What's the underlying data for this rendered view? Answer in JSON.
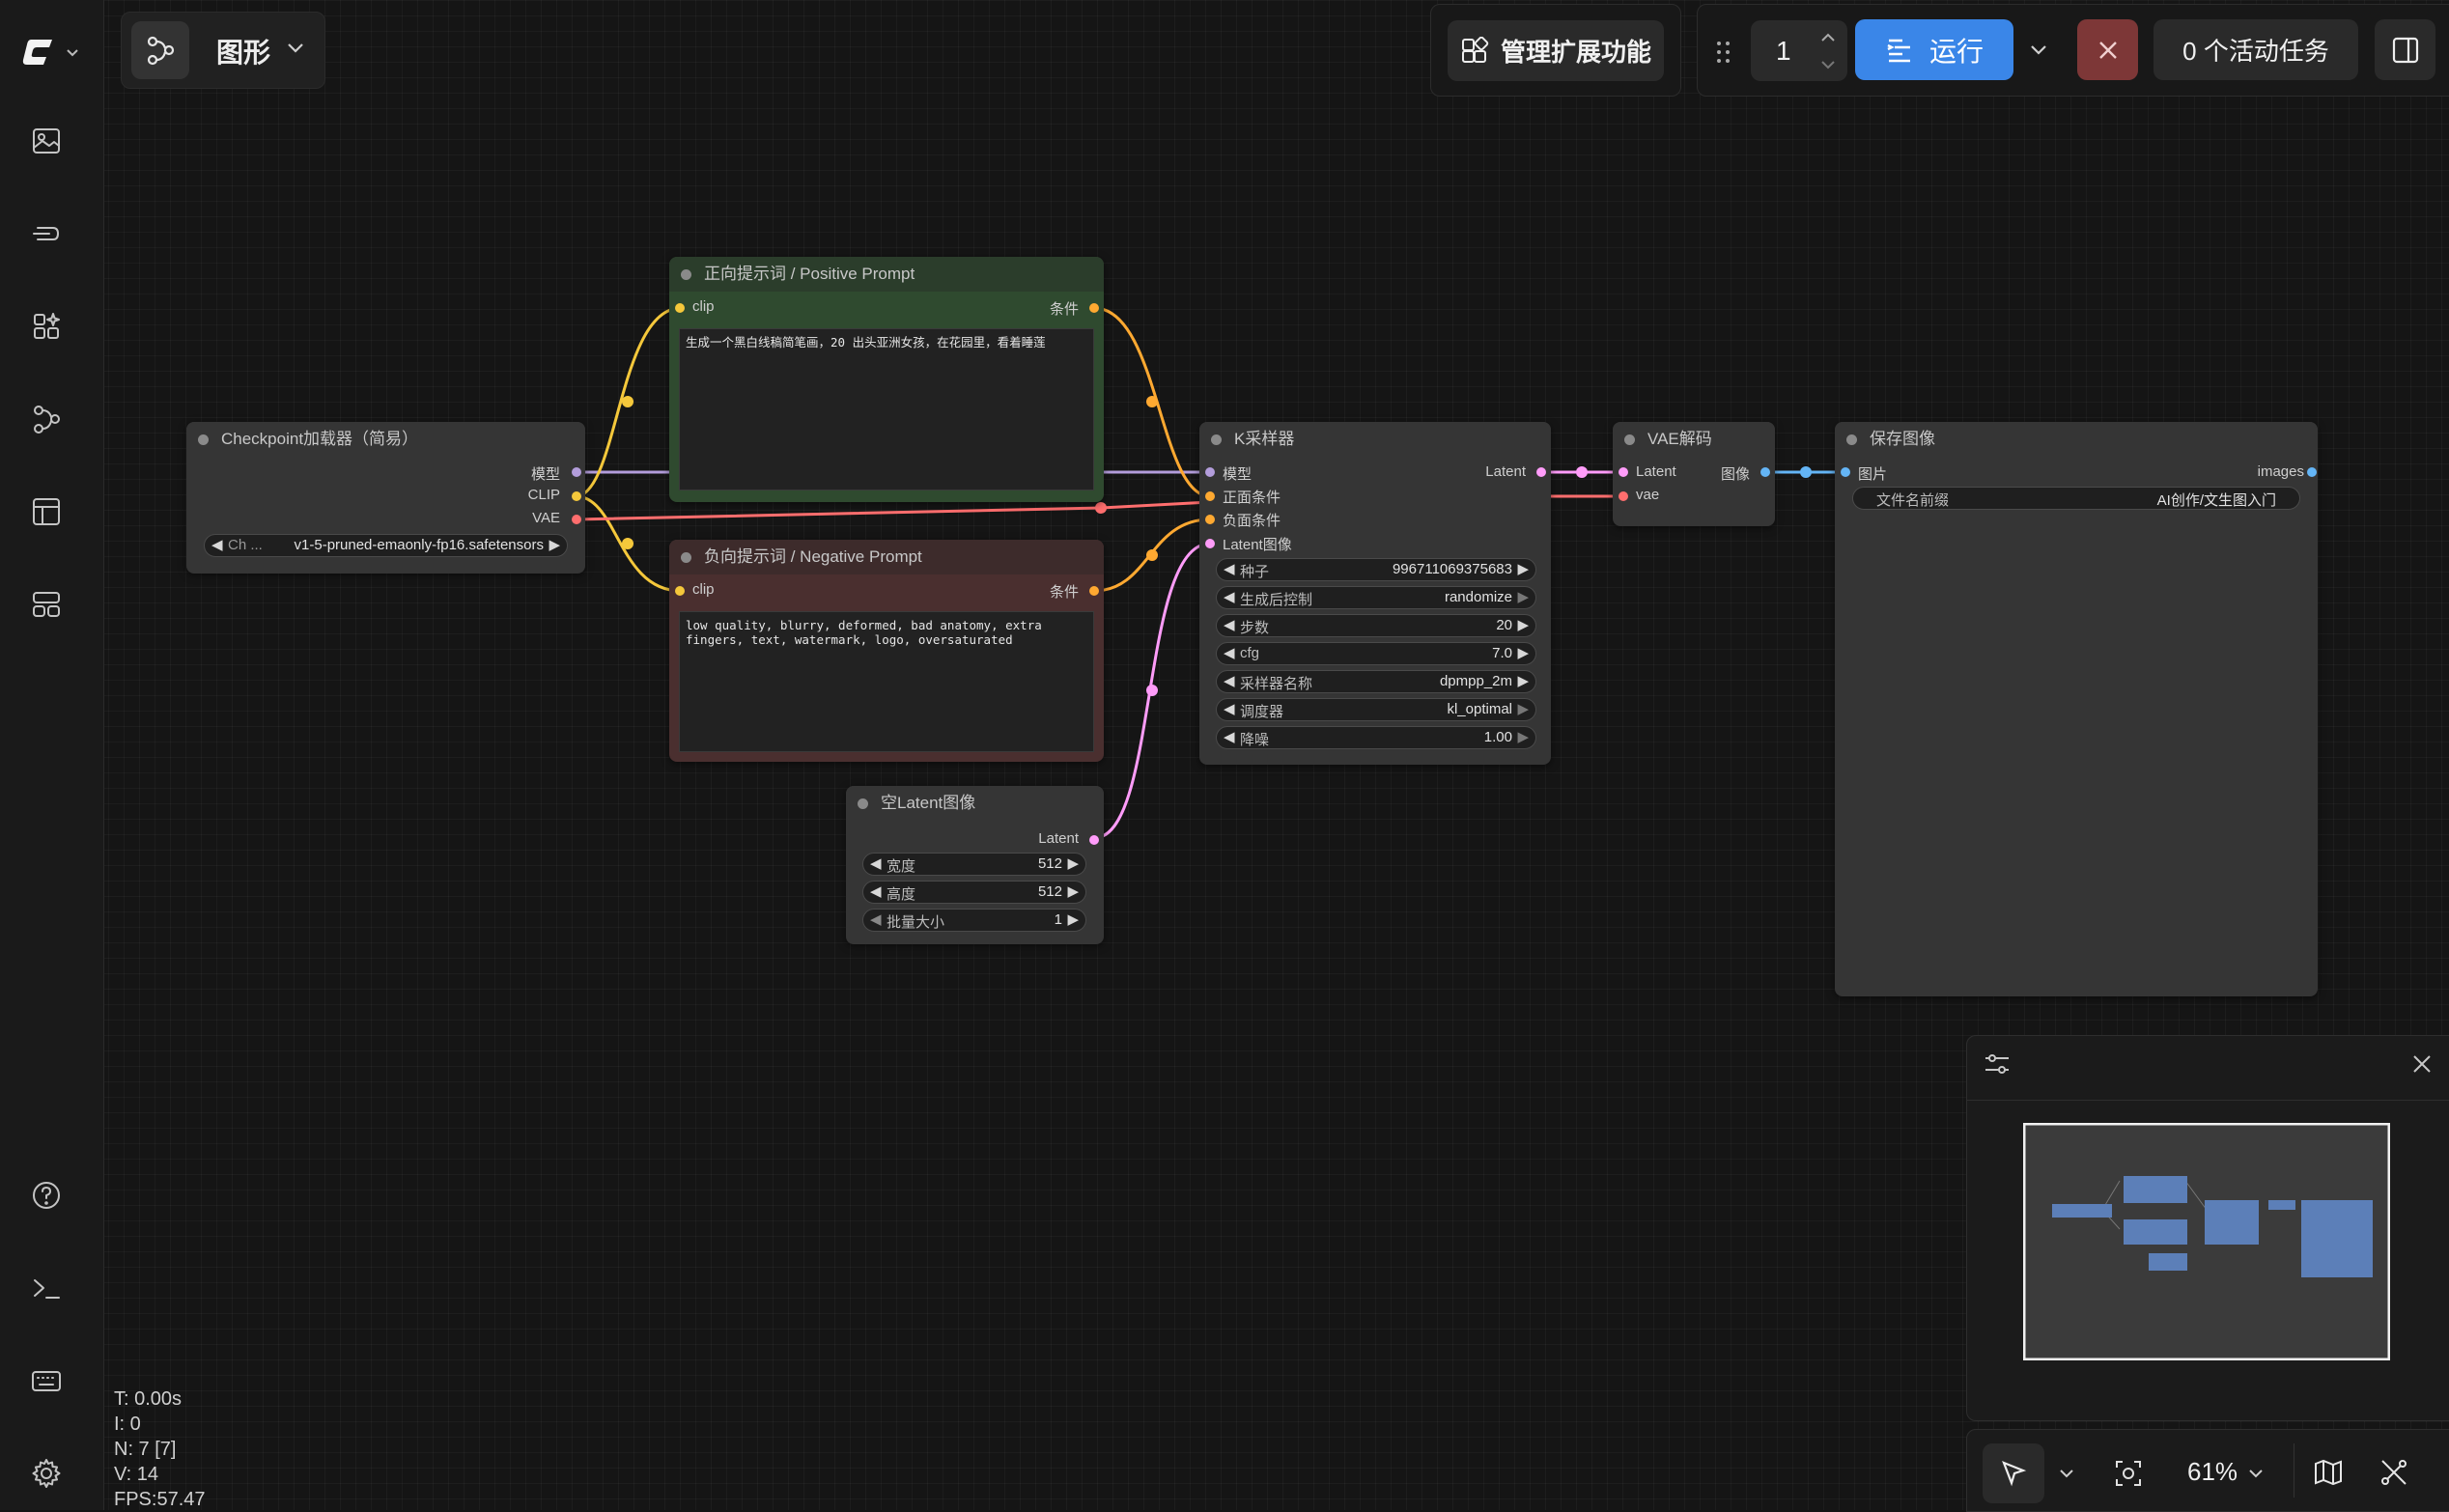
{
  "app": {
    "graph_tab_label": "图形"
  },
  "toolbar": {
    "manage_extensions": "管理扩展功能",
    "queue_count": "1",
    "run_label": "运行",
    "active_tasks": "0 个活动任务"
  },
  "sidebar": {
    "icons": [
      "images-icon",
      "model-library-icon",
      "node-library-icon",
      "workflows-icon",
      "templates-icon",
      "queue-icon"
    ],
    "bottom_icons": [
      "help-icon",
      "terminal-icon",
      "keyboard-icon",
      "settings-icon"
    ]
  },
  "nodes": {
    "checkpoint": {
      "title": "Checkpoint加载器（简易）",
      "outputs": [
        "模型",
        "CLIP",
        "VAE"
      ],
      "widget_label": "Ch ...",
      "widget_value": "v1-5-pruned-emaonly-fp16.safetensors"
    },
    "positive": {
      "title": "正向提示词 / Positive Prompt",
      "input": "clip",
      "output": "条件",
      "text": "生成一个黑白线稿简笔画，20 出头亚洲女孩，在花园里，看着睡莲"
    },
    "negative": {
      "title": "负向提示词 / Negative Prompt",
      "input": "clip",
      "output": "条件",
      "text": "low quality, blurry, deformed, bad anatomy, extra\nfingers, text, watermark, logo, oversaturated"
    },
    "empty_latent": {
      "title": "空Latent图像",
      "output": "Latent",
      "widgets": [
        {
          "label": "宽度",
          "value": "512"
        },
        {
          "label": "高度",
          "value": "512"
        },
        {
          "label": "批量大小",
          "value": "1"
        }
      ]
    },
    "ksampler": {
      "title": "K采样器",
      "inputs": [
        "模型",
        "正面条件",
        "负面条件",
        "Latent图像"
      ],
      "output": "Latent",
      "widgets": [
        {
          "label": "种子",
          "value": "996711069375683"
        },
        {
          "label": "生成后控制",
          "value": "randomize"
        },
        {
          "label": "步数",
          "value": "20"
        },
        {
          "label": "cfg",
          "value": "7.0"
        },
        {
          "label": "采样器名称",
          "value": "dpmpp_2m"
        },
        {
          "label": "调度器",
          "value": "kl_optimal"
        },
        {
          "label": "降噪",
          "value": "1.00"
        }
      ]
    },
    "vae_decode": {
      "title": "VAE解码",
      "inputs": [
        "Latent",
        "vae"
      ],
      "output": "图像"
    },
    "save_image": {
      "title": "保存图像",
      "input": "图片",
      "output": "images",
      "widget_label": "文件名前缀",
      "widget_value": "AI创作/文生图入门"
    }
  },
  "colors": {
    "clip": "#f5c83b",
    "model": "#b39ddb",
    "vae": "#ff6e6e",
    "latent": "#ff9cf9",
    "image": "#64b5f6",
    "conditioning": "#ffa931",
    "accent": "#3a86e8",
    "positive_node": "#2f4a2f",
    "negative_node": "#4a2f2f"
  },
  "zoom": "61%",
  "stats": [
    "T: 0.00s",
    "I: 0",
    "N: 7 [7]",
    "V: 14",
    "FPS:57.47"
  ]
}
